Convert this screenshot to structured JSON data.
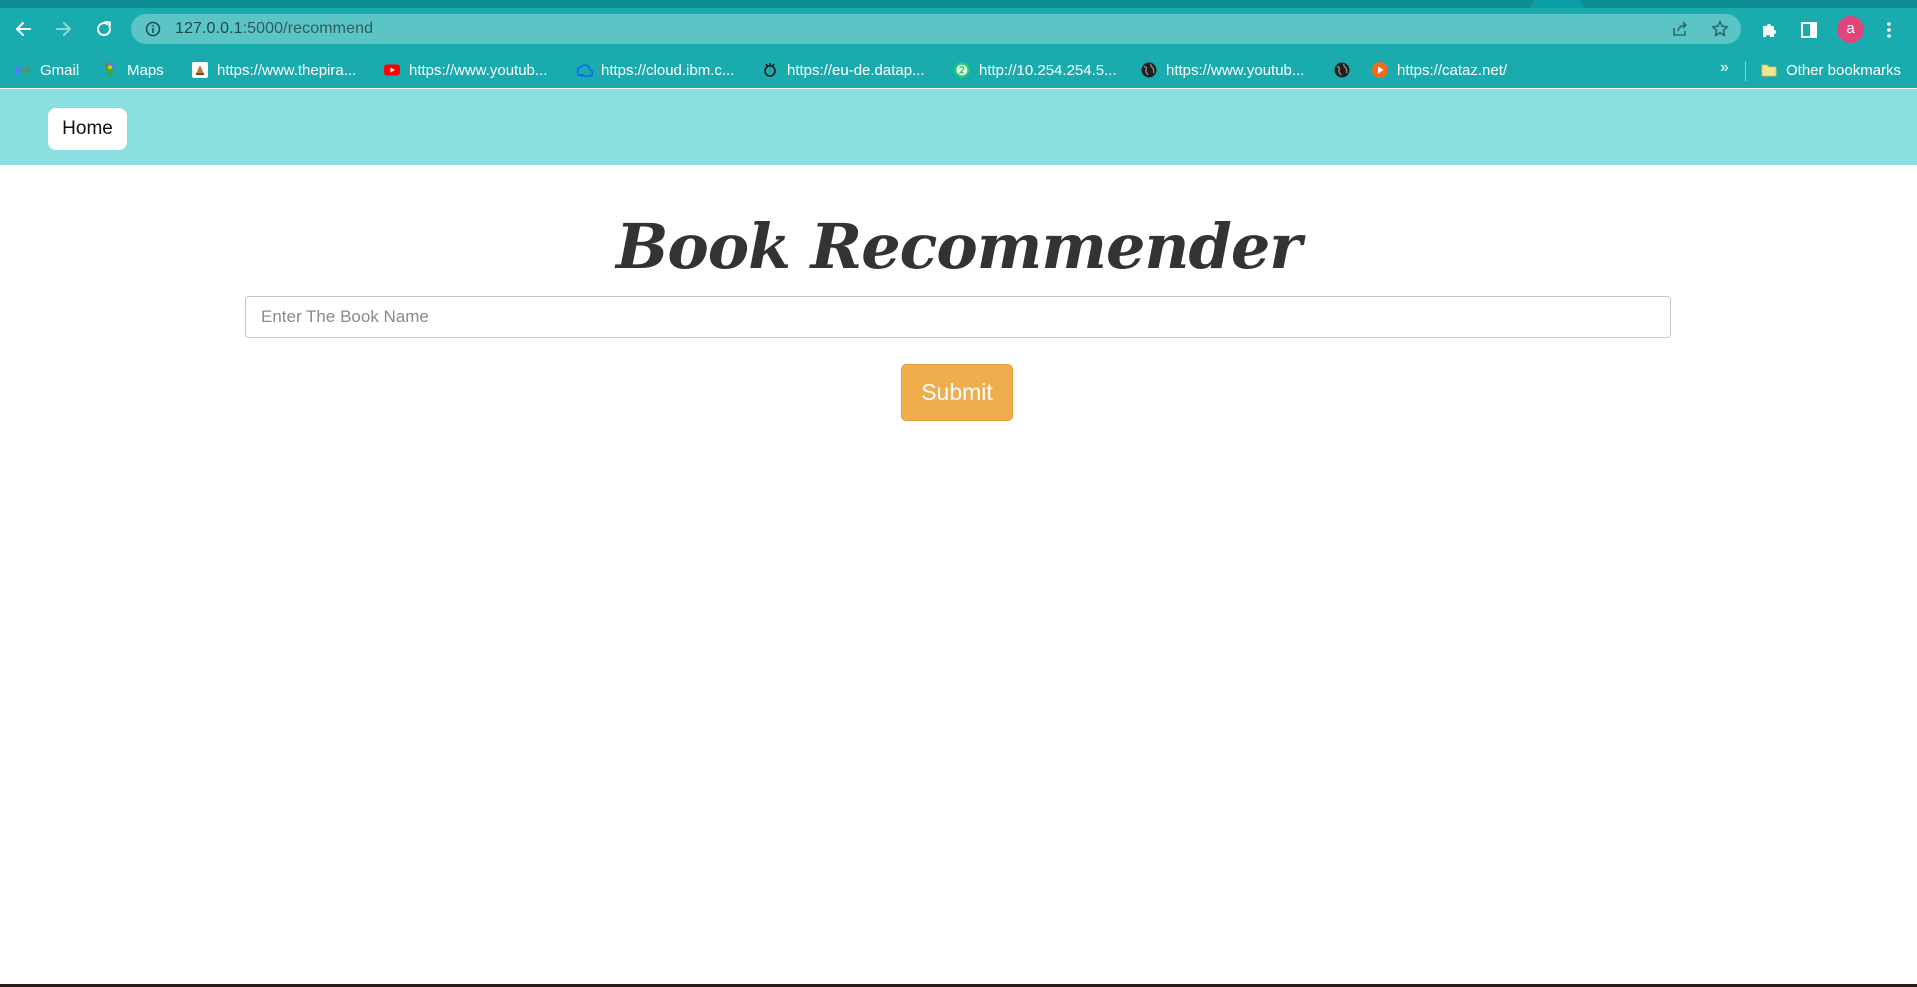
{
  "browser": {
    "url_host": "127.0.0.1",
    "url_path": ":5000/recommend",
    "avatar_initial": "a",
    "bookmarks": [
      {
        "label": "Gmail",
        "icon": "gmail-icon"
      },
      {
        "label": "Maps",
        "icon": "maps-icon"
      },
      {
        "label": "https://www.thepira...",
        "icon": "pirate-site-icon"
      },
      {
        "label": "https://www.youtub...",
        "icon": "youtube-icon"
      },
      {
        "label": "https://cloud.ibm.c...",
        "icon": "ibm-cloud-icon"
      },
      {
        "label": "https://eu-de.datap...",
        "icon": "dataplatform-icon"
      },
      {
        "label": "http://10.254.254.5...",
        "icon": "whatsapp-icon"
      },
      {
        "label": "https://www.youtub...",
        "icon": "globe-icon"
      },
      {
        "label": "",
        "icon": "globe-icon"
      },
      {
        "label": "https://cataz.net/",
        "icon": "play-icon"
      }
    ],
    "overflow_label": "»",
    "other_bookmarks_label": "Other bookmarks"
  },
  "page": {
    "nav": {
      "home_label": "Home"
    },
    "title": "Book Recommender",
    "search": {
      "placeholder": "Enter The Book Name",
      "value": ""
    },
    "submit_label": "Submit"
  },
  "colors": {
    "chrome": "#1aabae",
    "nav_bar": "#8ae0e0",
    "submit": "#f0ad4e",
    "title": "#333333",
    "avatar": "#e0457b"
  }
}
